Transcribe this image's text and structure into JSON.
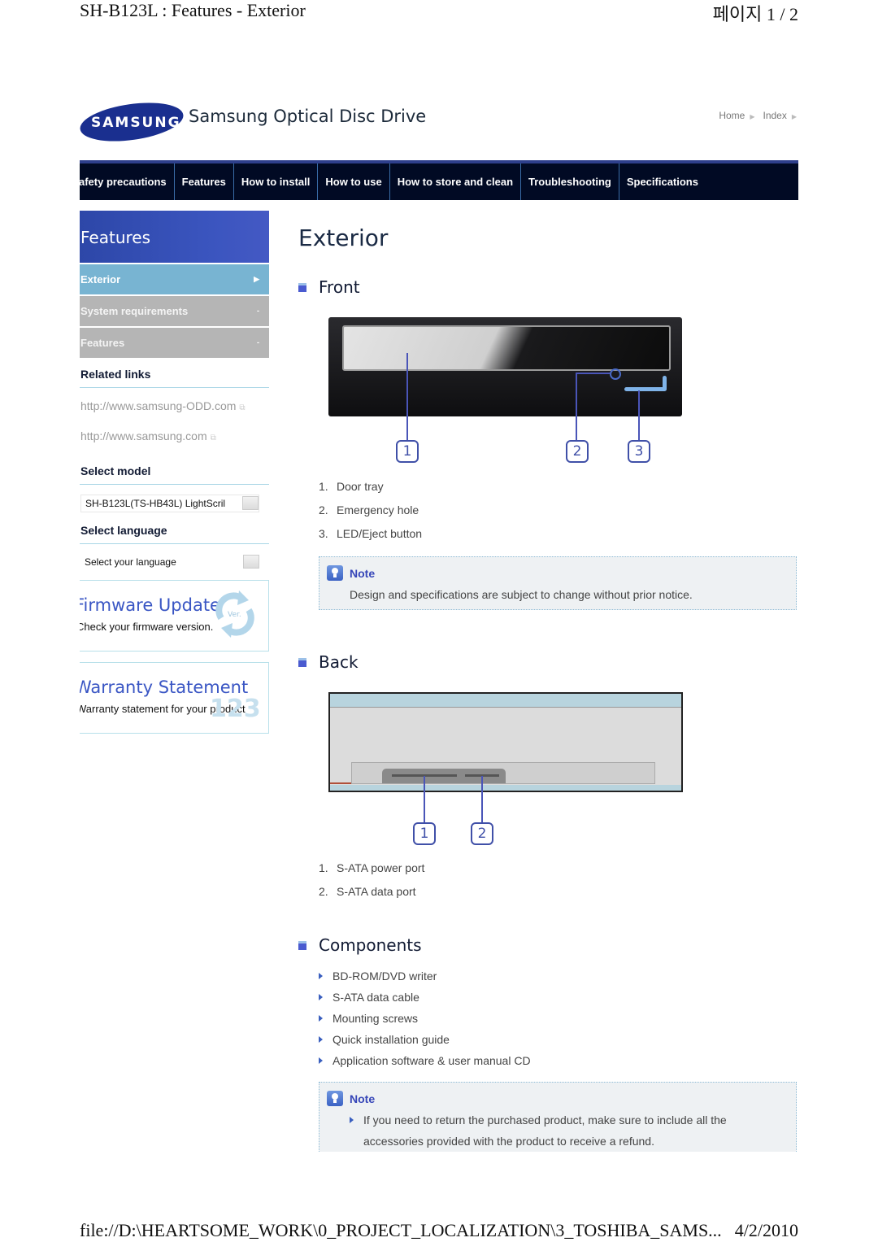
{
  "print_header": {
    "title": "SH-B123L : Features - Exterior",
    "page": "페이지 1 / 2"
  },
  "print_footer": {
    "path": "file://D:\\HEARTSOME_WORK\\0_PROJECT_LOCALIZATION\\3_TOSHIBA_SAMS...",
    "date": "4/2/2010"
  },
  "brand": {
    "logo_text": "SAMSUNG",
    "site_title": "Samsung Optical Disc Drive"
  },
  "utility_links": [
    {
      "label": "Home"
    },
    {
      "label": "Index"
    }
  ],
  "top_nav": [
    {
      "label": "afety precautions"
    },
    {
      "label": "Features"
    },
    {
      "label": "How to install"
    },
    {
      "label": "How to use"
    },
    {
      "label": "How to store and clean"
    },
    {
      "label": "Troubleshooting"
    },
    {
      "label": "Specifications"
    }
  ],
  "sidebar": {
    "header": "Features",
    "items": [
      {
        "label": "Exterior",
        "indicator": "▶",
        "active": true
      },
      {
        "label": "System requirements",
        "indicator": "-",
        "active": false
      },
      {
        "label": "Features",
        "indicator": "-",
        "active": false
      }
    ],
    "related_links_title": "Related links",
    "related_links": [
      {
        "label": "http://www.samsung-ODD.com",
        "icon": "external-link-icon"
      },
      {
        "label": "http://www.samsung.com",
        "icon": "external-link-icon"
      }
    ],
    "select_model_title": "Select model",
    "select_model_value": "SH-B123L(TS-HB43L) LightScril",
    "select_language_title": "Select language",
    "select_language_value": "Select your language",
    "firmware": {
      "title": "Firmware Update",
      "desc": "Check your firmware version.",
      "icon_label": "Ver."
    },
    "warranty": {
      "title": "Warranty Statement",
      "desc": "Warranty statement for your product",
      "icon_label": "123"
    }
  },
  "main": {
    "title": "Exterior",
    "front": {
      "title": "Front",
      "callouts": [
        "1",
        "2",
        "3"
      ],
      "items": [
        {
          "num": "1.",
          "label": "Door tray"
        },
        {
          "num": "2.",
          "label": "Emergency hole"
        },
        {
          "num": "3.",
          "label": "LED/Eject button"
        }
      ],
      "note": {
        "label": "Note",
        "text": "Design and specifications are subject to change without prior notice."
      }
    },
    "back": {
      "title": "Back",
      "callouts": [
        "1",
        "2"
      ],
      "items": [
        {
          "num": "1.",
          "label": "S-ATA power port"
        },
        {
          "num": "2.",
          "label": "S-ATA data port"
        }
      ]
    },
    "components": {
      "title": "Components",
      "items": [
        "BD-ROM/DVD writer",
        "S-ATA data cable",
        "Mounting screws",
        "Quick installation guide",
        "Application software & user manual CD"
      ],
      "note": {
        "label": "Note",
        "line1": "If you need to return the purchased product, make sure to include all the",
        "line2": "accessories provided with the product to receive a refund."
      }
    }
  }
}
